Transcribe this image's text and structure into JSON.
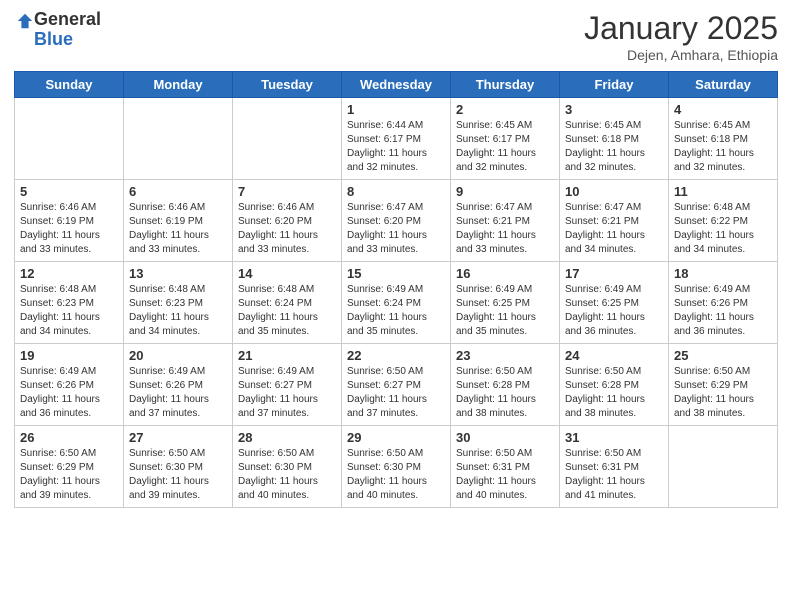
{
  "logo": {
    "general": "General",
    "blue": "Blue"
  },
  "title": "January 2025",
  "subtitle": "Dejen, Amhara, Ethiopia",
  "days": [
    "Sunday",
    "Monday",
    "Tuesday",
    "Wednesday",
    "Thursday",
    "Friday",
    "Saturday"
  ],
  "weeks": [
    [
      {
        "day": "",
        "info": ""
      },
      {
        "day": "",
        "info": ""
      },
      {
        "day": "",
        "info": ""
      },
      {
        "day": "1",
        "info": "Sunrise: 6:44 AM\nSunset: 6:17 PM\nDaylight: 11 hours and 32 minutes."
      },
      {
        "day": "2",
        "info": "Sunrise: 6:45 AM\nSunset: 6:17 PM\nDaylight: 11 hours and 32 minutes."
      },
      {
        "day": "3",
        "info": "Sunrise: 6:45 AM\nSunset: 6:18 PM\nDaylight: 11 hours and 32 minutes."
      },
      {
        "day": "4",
        "info": "Sunrise: 6:45 AM\nSunset: 6:18 PM\nDaylight: 11 hours and 32 minutes."
      }
    ],
    [
      {
        "day": "5",
        "info": "Sunrise: 6:46 AM\nSunset: 6:19 PM\nDaylight: 11 hours and 33 minutes."
      },
      {
        "day": "6",
        "info": "Sunrise: 6:46 AM\nSunset: 6:19 PM\nDaylight: 11 hours and 33 minutes."
      },
      {
        "day": "7",
        "info": "Sunrise: 6:46 AM\nSunset: 6:20 PM\nDaylight: 11 hours and 33 minutes."
      },
      {
        "day": "8",
        "info": "Sunrise: 6:47 AM\nSunset: 6:20 PM\nDaylight: 11 hours and 33 minutes."
      },
      {
        "day": "9",
        "info": "Sunrise: 6:47 AM\nSunset: 6:21 PM\nDaylight: 11 hours and 33 minutes."
      },
      {
        "day": "10",
        "info": "Sunrise: 6:47 AM\nSunset: 6:21 PM\nDaylight: 11 hours and 34 minutes."
      },
      {
        "day": "11",
        "info": "Sunrise: 6:48 AM\nSunset: 6:22 PM\nDaylight: 11 hours and 34 minutes."
      }
    ],
    [
      {
        "day": "12",
        "info": "Sunrise: 6:48 AM\nSunset: 6:23 PM\nDaylight: 11 hours and 34 minutes."
      },
      {
        "day": "13",
        "info": "Sunrise: 6:48 AM\nSunset: 6:23 PM\nDaylight: 11 hours and 34 minutes."
      },
      {
        "day": "14",
        "info": "Sunrise: 6:48 AM\nSunset: 6:24 PM\nDaylight: 11 hours and 35 minutes."
      },
      {
        "day": "15",
        "info": "Sunrise: 6:49 AM\nSunset: 6:24 PM\nDaylight: 11 hours and 35 minutes."
      },
      {
        "day": "16",
        "info": "Sunrise: 6:49 AM\nSunset: 6:25 PM\nDaylight: 11 hours and 35 minutes."
      },
      {
        "day": "17",
        "info": "Sunrise: 6:49 AM\nSunset: 6:25 PM\nDaylight: 11 hours and 36 minutes."
      },
      {
        "day": "18",
        "info": "Sunrise: 6:49 AM\nSunset: 6:26 PM\nDaylight: 11 hours and 36 minutes."
      }
    ],
    [
      {
        "day": "19",
        "info": "Sunrise: 6:49 AM\nSunset: 6:26 PM\nDaylight: 11 hours and 36 minutes."
      },
      {
        "day": "20",
        "info": "Sunrise: 6:49 AM\nSunset: 6:26 PM\nDaylight: 11 hours and 37 minutes."
      },
      {
        "day": "21",
        "info": "Sunrise: 6:49 AM\nSunset: 6:27 PM\nDaylight: 11 hours and 37 minutes."
      },
      {
        "day": "22",
        "info": "Sunrise: 6:50 AM\nSunset: 6:27 PM\nDaylight: 11 hours and 37 minutes."
      },
      {
        "day": "23",
        "info": "Sunrise: 6:50 AM\nSunset: 6:28 PM\nDaylight: 11 hours and 38 minutes."
      },
      {
        "day": "24",
        "info": "Sunrise: 6:50 AM\nSunset: 6:28 PM\nDaylight: 11 hours and 38 minutes."
      },
      {
        "day": "25",
        "info": "Sunrise: 6:50 AM\nSunset: 6:29 PM\nDaylight: 11 hours and 38 minutes."
      }
    ],
    [
      {
        "day": "26",
        "info": "Sunrise: 6:50 AM\nSunset: 6:29 PM\nDaylight: 11 hours and 39 minutes."
      },
      {
        "day": "27",
        "info": "Sunrise: 6:50 AM\nSunset: 6:30 PM\nDaylight: 11 hours and 39 minutes."
      },
      {
        "day": "28",
        "info": "Sunrise: 6:50 AM\nSunset: 6:30 PM\nDaylight: 11 hours and 40 minutes."
      },
      {
        "day": "29",
        "info": "Sunrise: 6:50 AM\nSunset: 6:30 PM\nDaylight: 11 hours and 40 minutes."
      },
      {
        "day": "30",
        "info": "Sunrise: 6:50 AM\nSunset: 6:31 PM\nDaylight: 11 hours and 40 minutes."
      },
      {
        "day": "31",
        "info": "Sunrise: 6:50 AM\nSunset: 6:31 PM\nDaylight: 11 hours and 41 minutes."
      },
      {
        "day": "",
        "info": ""
      }
    ]
  ]
}
